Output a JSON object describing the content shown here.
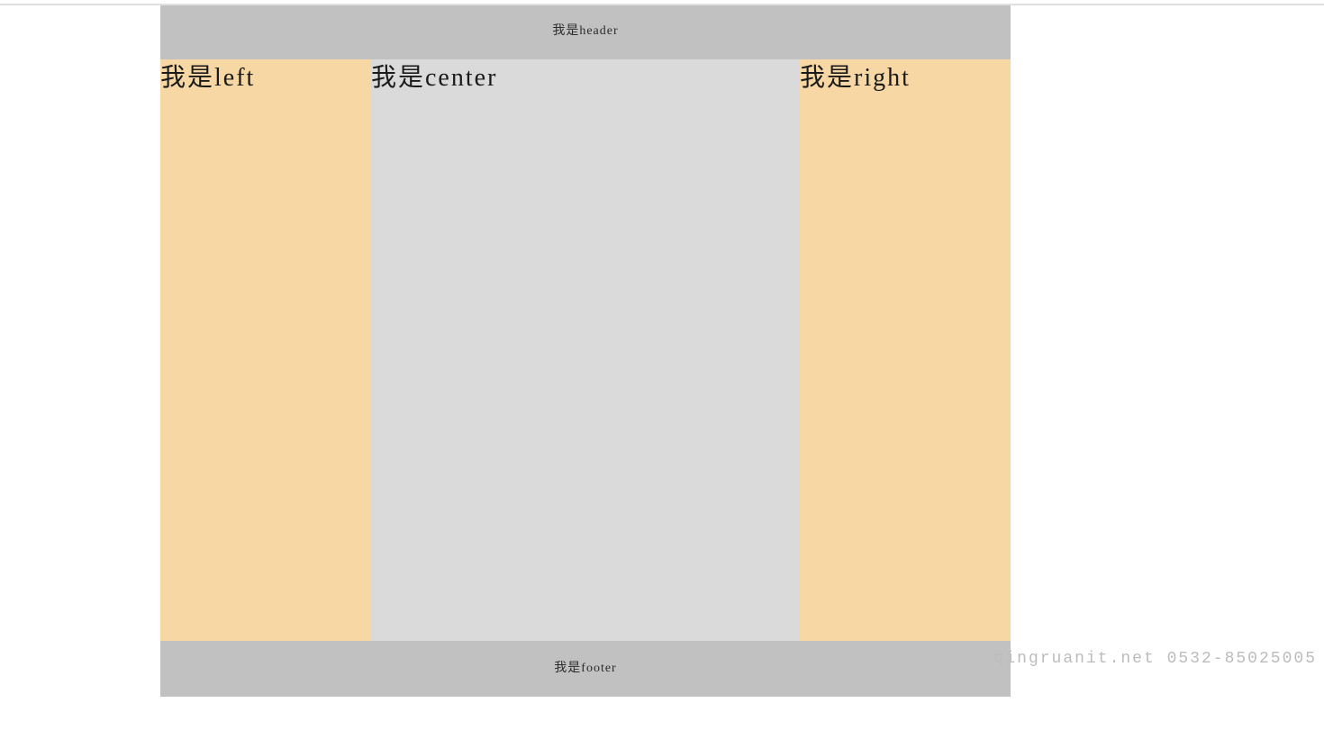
{
  "layout": {
    "header_text": "我是header",
    "left_text": "我是left",
    "center_text": "我是center",
    "right_text": "我是right",
    "footer_text": "我是footer"
  },
  "watermark": {
    "text": "qingruanit.net 0532-85025005"
  },
  "colors": {
    "header_bg": "#c1c1c1",
    "footer_bg": "#c1c1c1",
    "side_bg": "#f7d8a5",
    "center_bg": "#dadada"
  }
}
